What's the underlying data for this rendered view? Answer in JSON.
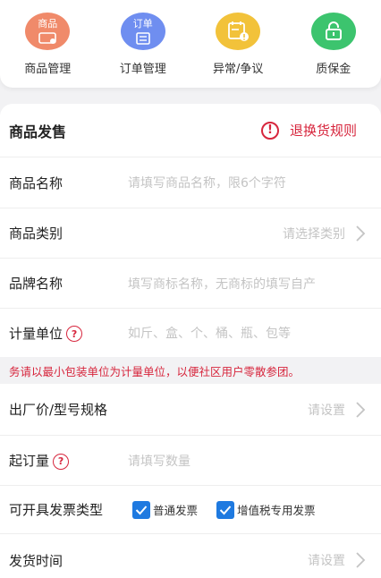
{
  "nav": {
    "items": [
      {
        "label": "商品管理",
        "icon_text": "商品",
        "color": "#f08a6a",
        "icon": "goods-icon"
      },
      {
        "label": "订单管理",
        "icon_text": "订单",
        "color": "#6f8ef0",
        "icon": "order-icon"
      },
      {
        "label": "异常/争议",
        "icon_text": "",
        "color": "#f2c23a",
        "icon": "dispute-icon"
      },
      {
        "label": "质保金",
        "icon_text": "",
        "color": "#3cc46e",
        "icon": "deposit-icon"
      }
    ]
  },
  "form": {
    "title": "商品发售",
    "rules_link": "退换货规则",
    "fields": {
      "name": {
        "label": "商品名称",
        "placeholder": "请填写商品名称，限6个字符"
      },
      "category": {
        "label": "商品类别",
        "placeholder": "请选择类别"
      },
      "brand": {
        "label": "品牌名称",
        "placeholder": "填写商标名称，无商标的填写自产"
      },
      "unit": {
        "label": "计量单位",
        "placeholder": "如斤、盒、个、桶、瓶、包等"
      },
      "price": {
        "label": "出厂价/型号规格",
        "placeholder": "请设置"
      },
      "moq": {
        "label": "起订量",
        "placeholder": "请填写数量"
      },
      "invoice": {
        "label": "可开具发票类型",
        "options": [
          "普通发票",
          "增值税专用发票"
        ]
      },
      "ship_time": {
        "label": "发货时间",
        "placeholder": "请设置"
      }
    },
    "notice": "务请以最小包装单位为计量单位，以便社区用户零散参团。",
    "help_glyph": "?",
    "warn_glyph": "!"
  },
  "colors": {
    "accent_red": "#d7263d",
    "check_blue": "#1f7ae0"
  }
}
